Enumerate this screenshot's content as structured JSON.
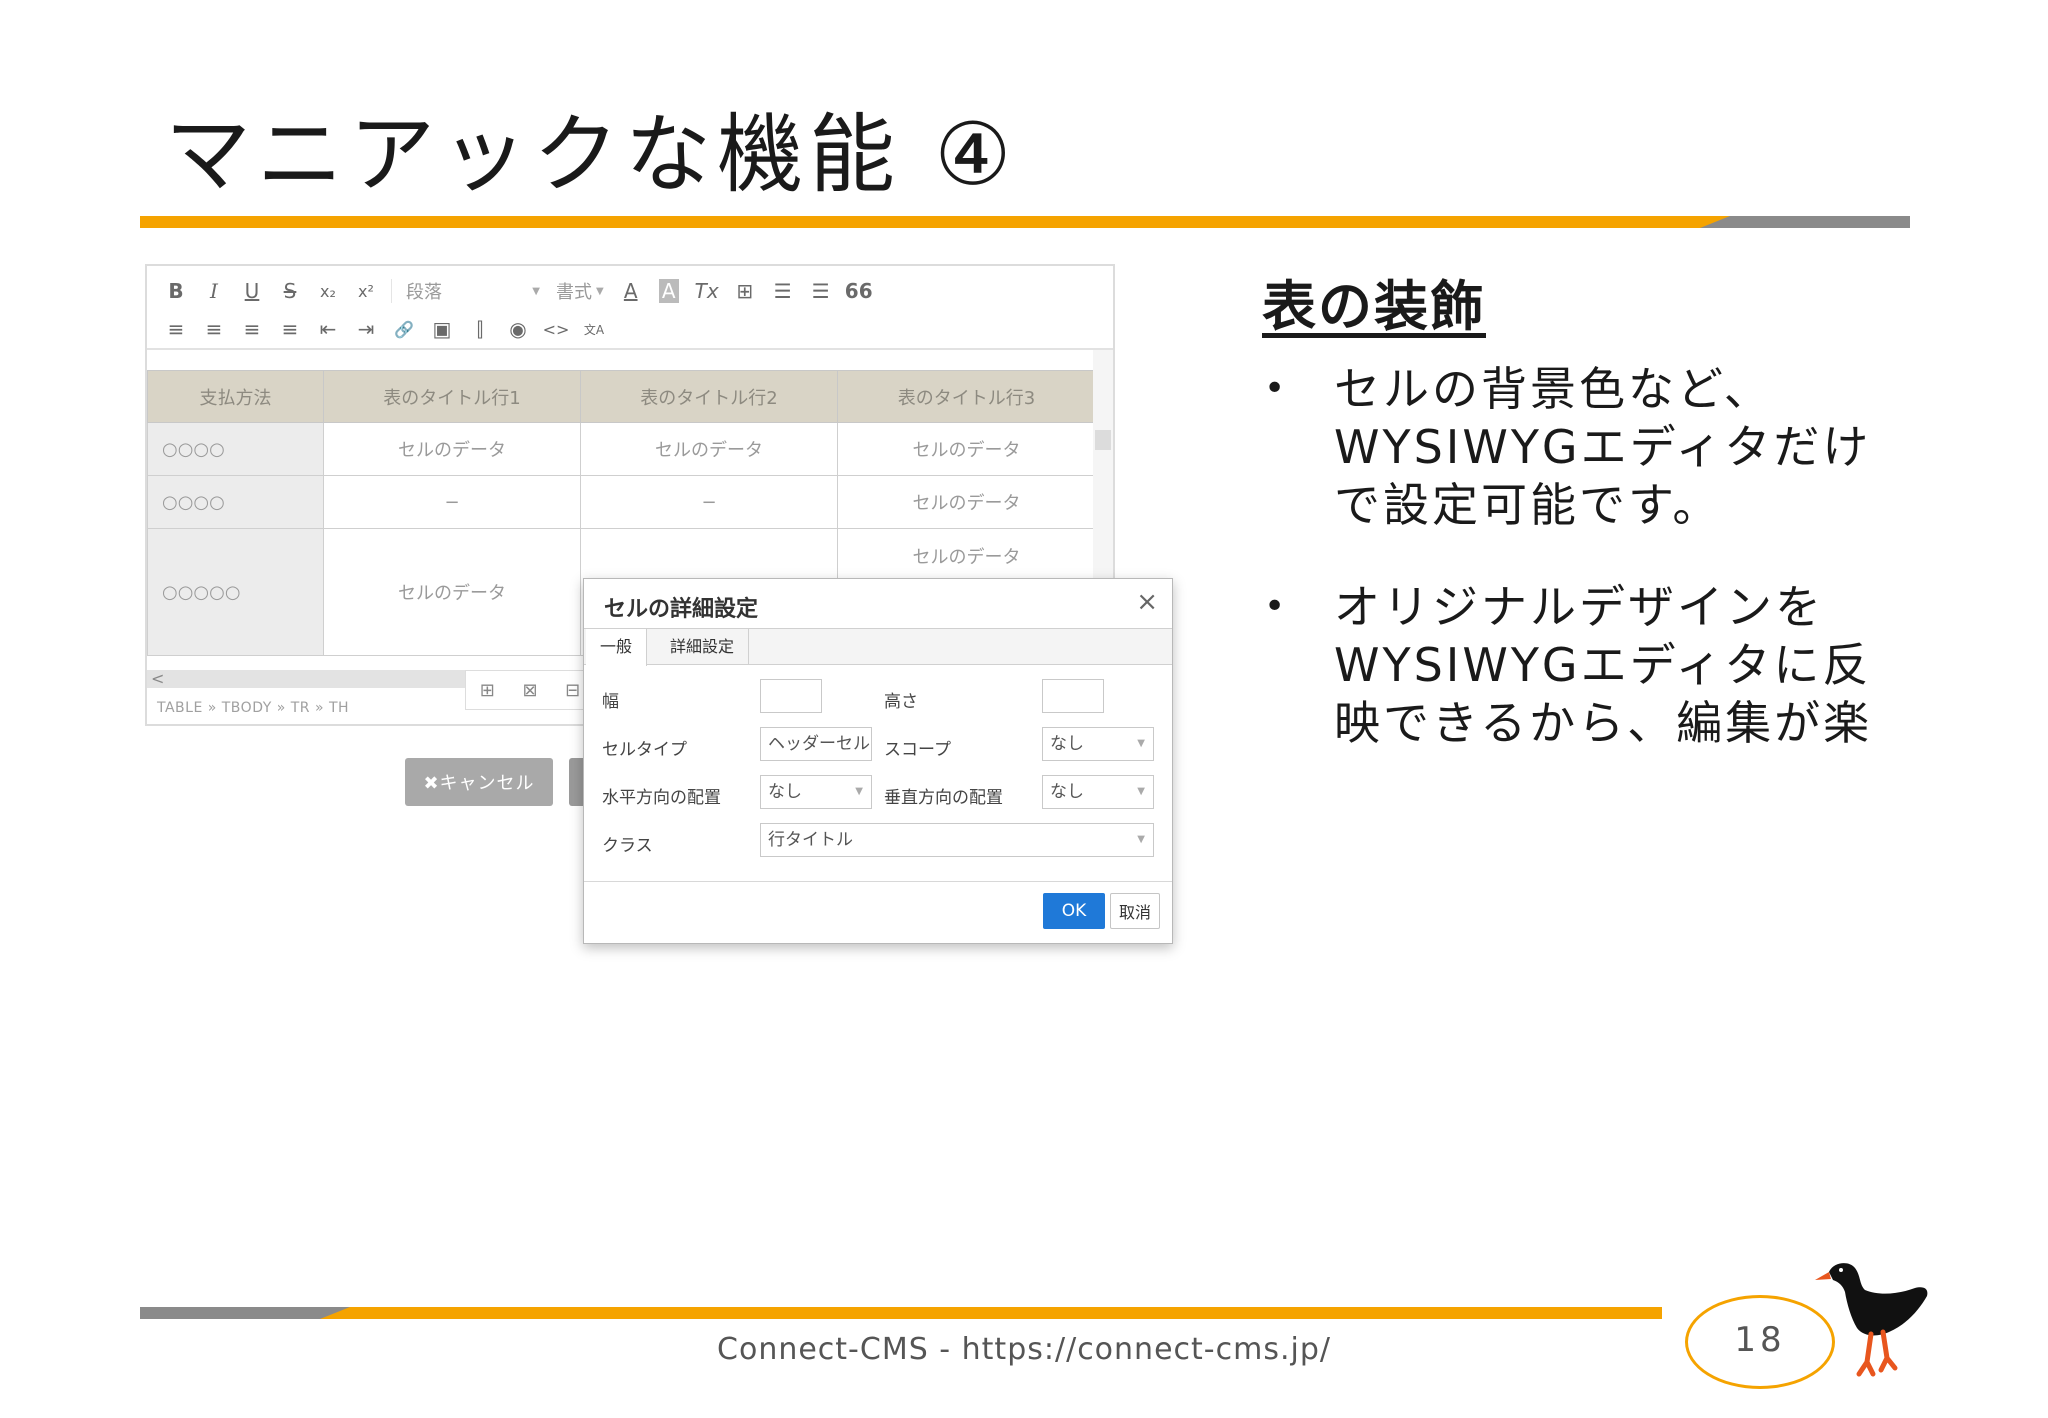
{
  "slide": {
    "title": "マニアックな機能 ④",
    "footer": "Connect-CMS - https://connect-cms.jp/",
    "page_number": "18"
  },
  "right_panel": {
    "heading": "表の装飾",
    "bullets": [
      "セルの背景色など、WYSIWYGエディタだけで設定可能です。",
      "オリジナルデザインをWYSIWYGエディタに反映できるから、編集が楽"
    ],
    "bullet_marker": "•"
  },
  "editor": {
    "toolbar_row1": [
      "B",
      "I",
      "U",
      "S",
      "x₂",
      "x²"
    ],
    "format_dropdown": "段落",
    "style_dropdown": "書式",
    "toolbar_row1_extra": [
      "A",
      "A",
      "Tx",
      "⊞",
      "☰",
      "☰",
      "66"
    ],
    "toolbar_row2": [
      "≡",
      "≡",
      "≡",
      "≡",
      "⇤",
      "⇥",
      "🔗",
      "▣",
      "⫿",
      "◉",
      "<>",
      "文A"
    ],
    "table": {
      "headers": [
        "支払方法",
        "表のタイトル行1",
        "表のタイトル行2",
        "表のタイトル行3"
      ],
      "rows": [
        [
          "○○○○",
          "セルのデータ",
          "セルのデータ",
          "セルのデータ"
        ],
        [
          "○○○○",
          "−",
          "−",
          "セルのデータ"
        ],
        [
          "○○○○○",
          "セルのデータ",
          "",
          "セルのデータ"
        ]
      ]
    },
    "scroll_left": "<",
    "element_path": "TABLE » TBODY » TR » TH",
    "mini_tools": [
      "⊞",
      "⊠",
      "⊟"
    ],
    "cancel_button": "✖キャンセル"
  },
  "dialog": {
    "title": "セルの詳細設定",
    "close": "×",
    "tabs": [
      "一般",
      "詳細設定"
    ],
    "fields": {
      "width_label": "幅",
      "width_value": "",
      "height_label": "高さ",
      "height_value": "",
      "cell_type_label": "セルタイプ",
      "cell_type_value": "ヘッダーセル",
      "scope_label": "スコープ",
      "scope_value": "なし",
      "h_align_label": "水平方向の配置",
      "h_align_value": "なし",
      "v_align_label": "垂直方向の配置",
      "v_align_value": "なし",
      "class_label": "クラス",
      "class_value": "行タイトル"
    },
    "ok": "OK",
    "cancel": "取消"
  },
  "colors": {
    "accent_orange": "#f5a300",
    "rule_gray": "#8a8a8a",
    "header_cell_bg": "#d9d4c6",
    "ok_blue": "#1f79d8"
  }
}
